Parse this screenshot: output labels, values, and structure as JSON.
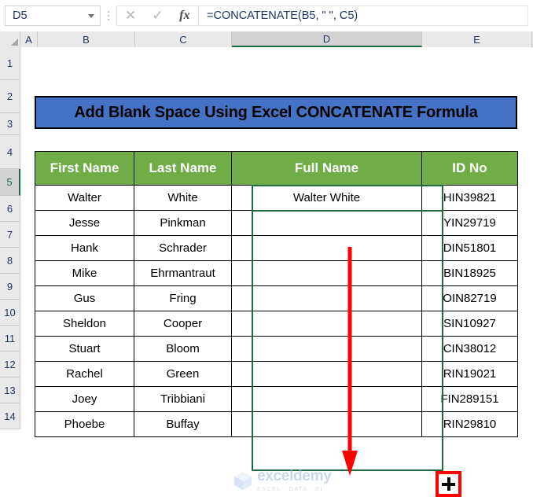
{
  "formula_bar": {
    "name_box_value": "D5",
    "name_box_icon": "chevron-down-icon",
    "grip_icon": "vertical-dots-icon",
    "cancel_icon": "✕",
    "confirm_icon": "✓",
    "function_icon": "fx",
    "formula_value": "=CONCATENATE(B5, \" \", C5)"
  },
  "grid": {
    "corner_icon": "select-all-triangle-icon",
    "columns": [
      "A",
      "B",
      "C",
      "D",
      "E"
    ],
    "active_column": "D",
    "rows": [
      "1",
      "2",
      "3",
      "4",
      "5",
      "6",
      "7",
      "8",
      "9",
      "10",
      "11",
      "12",
      "13",
      "14"
    ],
    "active_row": "5"
  },
  "title": {
    "text": "Add Blank Space Using Excel CONCATENATE Formula",
    "background_color": "#4472C4",
    "text_color": "#000000"
  },
  "table": {
    "header_background": "#70AD47",
    "header_text_color": "#FFFFFF",
    "headers": [
      "First Name",
      "Last Name",
      "Full Name",
      "ID No"
    ],
    "rows": [
      {
        "first": "Walter",
        "last": "White",
        "full": "Walter White",
        "id": "HIN39821"
      },
      {
        "first": "Jesse",
        "last": "Pinkman",
        "full": "",
        "id": "YIN29719"
      },
      {
        "first": "Hank",
        "last": "Schrader",
        "full": "",
        "id": "DIN51801"
      },
      {
        "first": "Mike",
        "last": "Ehrmantraut",
        "full": "",
        "id": "BIN18925"
      },
      {
        "first": "Gus",
        "last": "Fring",
        "full": "",
        "id": "OIN82719"
      },
      {
        "first": "Sheldon",
        "last": "Cooper",
        "full": "",
        "id": "SIN10927"
      },
      {
        "first": "Stuart",
        "last": "Bloom",
        "full": "",
        "id": "CIN38012"
      },
      {
        "first": "Rachel",
        "last": "Green",
        "full": "",
        "id": "RIN19021"
      },
      {
        "first": "Joey",
        "last": "Tribbiani",
        "full": "",
        "id": "FIN289151"
      },
      {
        "first": "Phoebe",
        "last": "Buffay",
        "full": "",
        "id": "RIN29810"
      }
    ]
  },
  "annotations": {
    "arrow_icon": "down-arrow-icon",
    "arrow_color": "#FF0000",
    "fill_handle_icon": "plus-cursor-icon",
    "fill_handle_border_color": "#FF0000",
    "selection_color": "#1E6B41"
  },
  "watermark": {
    "name": "exceldemy",
    "tagline": "EXCEL · DATA · BI",
    "logo_icon": "cube-logo-icon"
  }
}
